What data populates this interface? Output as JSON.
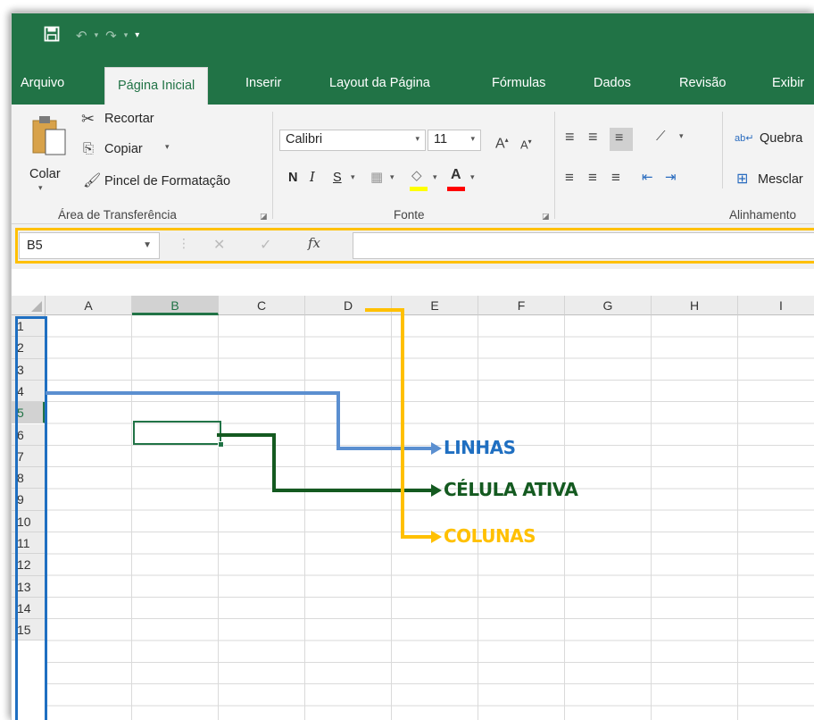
{
  "qat": {
    "save_icon": "save-icon",
    "undo_icon": "undo-icon",
    "redo_icon": "redo-icon",
    "customize_icon": "customize-qat-icon"
  },
  "tabs": [
    {
      "label": "Arquivo"
    },
    {
      "label": "Página Inicial",
      "active": true
    },
    {
      "label": "Inserir"
    },
    {
      "label": "Layout da Página"
    },
    {
      "label": "Fórmulas"
    },
    {
      "label": "Dados"
    },
    {
      "label": "Revisão"
    },
    {
      "label": "Exibir"
    }
  ],
  "clipboard": {
    "paste": "Colar",
    "cut": "Recortar",
    "copy": "Copiar",
    "format_painter": "Pincel de Formatação",
    "group_label": "Área de Transferência"
  },
  "font": {
    "name": "Calibri",
    "size": "11",
    "bold": "N",
    "italic": "I",
    "underline": "S",
    "group_label": "Fonte",
    "highlight_color": "#ffff00",
    "font_color": "#ff0000"
  },
  "alignment": {
    "wrap": "Quebra",
    "merge": "Mesclar",
    "group_label": "Alinhamento"
  },
  "formula_bar": {
    "name_box": "B5",
    "cancel": "✕",
    "enter": "✓",
    "fx": "fx",
    "value": ""
  },
  "columns": [
    "A",
    "B",
    "C",
    "D",
    "E",
    "F",
    "G",
    "H",
    "I"
  ],
  "rows": [
    "1",
    "2",
    "3",
    "4",
    "5",
    "6",
    "7",
    "8",
    "9",
    "10",
    "11",
    "12",
    "13",
    "14",
    "15"
  ],
  "selected": {
    "column": "B",
    "row": "5"
  },
  "callouts": {
    "rows": {
      "label": "LINHAS",
      "color": "#1f6fc1"
    },
    "active_cell": {
      "label": "CÉLULA ATIVA",
      "color": "#145a20"
    },
    "columns": {
      "label": "COLUNAS",
      "color": "#ffc000"
    }
  },
  "colors": {
    "accent": "#217346"
  }
}
